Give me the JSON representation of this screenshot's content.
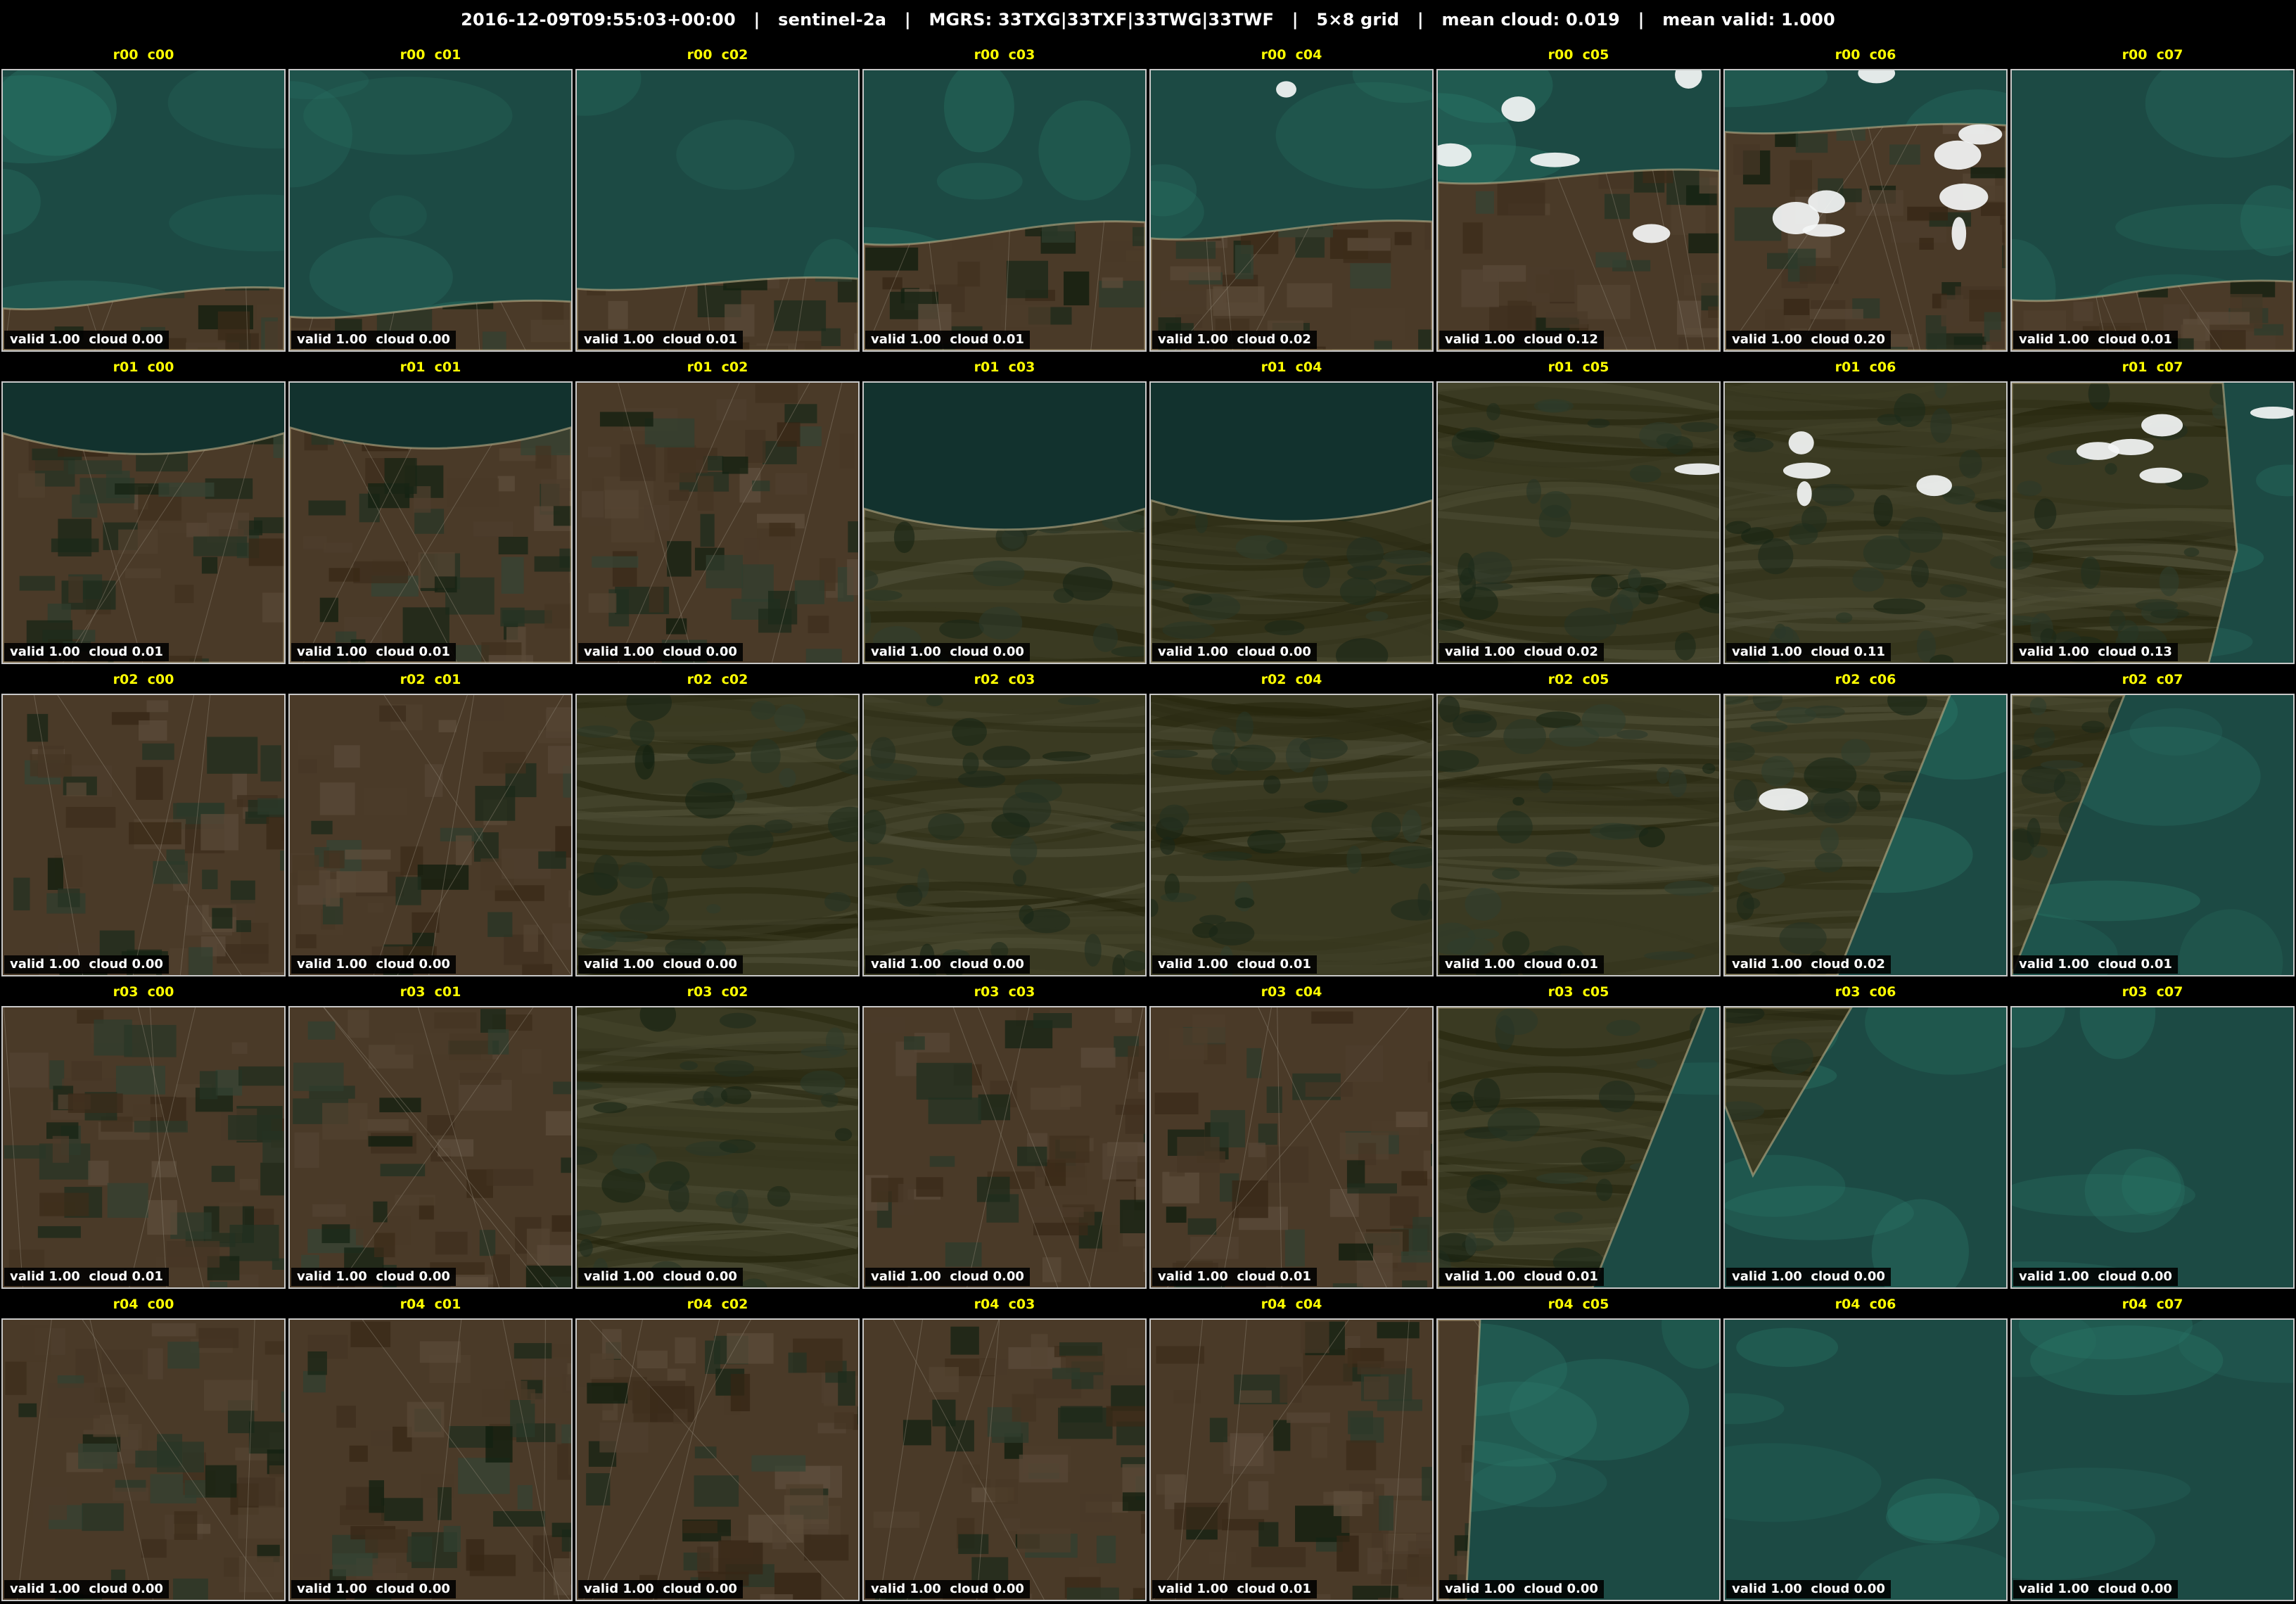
{
  "header": {
    "text": "2016-12-09T09:55:03+00:00   |   sentinel-2a   |   MGRS: 33TXG|33TXF|33TWG|33TWF   |   5×8 grid   |   mean cloud: 0.019   |   mean valid: 1.000"
  },
  "colors": {
    "sea": "#1c4a44",
    "sea_shallow": "#2a7a6a",
    "land": "#3a3a22",
    "farmland": "#4a3a28",
    "forest": "#223020",
    "cloud": "#f4f6f6",
    "label": "#ffff00",
    "border": "#c8c8c8"
  },
  "grid": {
    "rows": [
      {
        "cells": [
          {
            "label": "r00  c00",
            "stats": "valid 1.00  cloud 0.00",
            "scene": "sea-coast",
            "coast": 0.85,
            "cloud_fraction": 0.0
          },
          {
            "label": "r00  c01",
            "stats": "valid 1.00  cloud 0.00",
            "scene": "sea-coast",
            "coast": 0.88,
            "cloud_fraction": 0.0
          },
          {
            "label": "r00  c02",
            "stats": "valid 1.00  cloud 0.01",
            "scene": "sea-coast",
            "coast": 0.78,
            "cloud_fraction": 0.01
          },
          {
            "label": "r00  c03",
            "stats": "valid 1.00  cloud 0.01",
            "scene": "sea-lagoon",
            "coast": 0.62,
            "cloud_fraction": 0.01
          },
          {
            "label": "r00  c04",
            "stats": "valid 1.00  cloud 0.02",
            "scene": "sea-lagoon",
            "coast": 0.6,
            "cloud_fraction": 0.02
          },
          {
            "label": "r00  c05",
            "stats": "valid 1.00  cloud 0.12",
            "scene": "sea-coast",
            "coast": 0.4,
            "cloud_fraction": 0.12
          },
          {
            "label": "r00  c06",
            "stats": "valid 1.00  cloud 0.20",
            "scene": "sea-coast",
            "coast": 0.22,
            "cloud_fraction": 0.2
          },
          {
            "label": "r00  c07",
            "stats": "valid 1.00  cloud 0.01",
            "scene": "sea-coast",
            "coast": 0.82,
            "cloud_fraction": 0.01
          }
        ]
      },
      {
        "cells": [
          {
            "label": "r01  c00",
            "stats": "valid 1.00  cloud 0.01",
            "scene": "lake-farmland",
            "coast": 0.18,
            "cloud_fraction": 0.01
          },
          {
            "label": "r01  c01",
            "stats": "valid 1.00  cloud 0.01",
            "scene": "lake-farmland",
            "coast": 0.16,
            "cloud_fraction": 0.01
          },
          {
            "label": "r01  c02",
            "stats": "valid 1.00  cloud 0.00",
            "scene": "farmland",
            "coast": 0.0,
            "cloud_fraction": 0.0
          },
          {
            "label": "r01  c03",
            "stats": "valid 1.00  cloud 0.00",
            "scene": "lake-forest",
            "coast": 0.45,
            "cloud_fraction": 0.0
          },
          {
            "label": "r01  c04",
            "stats": "valid 1.00  cloud 0.00",
            "scene": "lake-forest",
            "coast": 0.42,
            "cloud_fraction": 0.0
          },
          {
            "label": "r01  c05",
            "stats": "valid 1.00  cloud 0.02",
            "scene": "mountain",
            "coast": 0.0,
            "cloud_fraction": 0.02
          },
          {
            "label": "r01  c06",
            "stats": "valid 1.00  cloud 0.11",
            "scene": "mountain",
            "coast": 0.0,
            "cloud_fraction": 0.11
          },
          {
            "label": "r01  c07",
            "stats": "valid 1.00  cloud 0.13",
            "scene": "coast-east",
            "coast": 0.75,
            "cloud_fraction": 0.13
          }
        ]
      },
      {
        "cells": [
          {
            "label": "r02  c00",
            "stats": "valid 1.00  cloud 0.00",
            "scene": "farmland",
            "coast": 0.0,
            "cloud_fraction": 0.0
          },
          {
            "label": "r02  c01",
            "stats": "valid 1.00  cloud 0.00",
            "scene": "farmland",
            "coast": 0.0,
            "cloud_fraction": 0.0
          },
          {
            "label": "r02  c02",
            "stats": "valid 1.00  cloud 0.00",
            "scene": "mountain",
            "coast": 0.0,
            "cloud_fraction": 0.0
          },
          {
            "label": "r02  c03",
            "stats": "valid 1.00  cloud 0.00",
            "scene": "mountain",
            "coast": 0.0,
            "cloud_fraction": 0.0
          },
          {
            "label": "r02  c04",
            "stats": "valid 1.00  cloud 0.01",
            "scene": "mountain",
            "coast": 0.0,
            "cloud_fraction": 0.01
          },
          {
            "label": "r02  c05",
            "stats": "valid 1.00  cloud 0.01",
            "scene": "mountain",
            "coast": 0.0,
            "cloud_fraction": 0.01
          },
          {
            "label": "r02  c06",
            "stats": "valid 1.00  cloud 0.02",
            "scene": "coast-diagonal",
            "coast": 0.7,
            "cloud_fraction": 0.02
          },
          {
            "label": "r02  c07",
            "stats": "valid 1.00  cloud 0.01",
            "scene": "coast-diagonal",
            "coast": 0.3,
            "cloud_fraction": 0.01
          }
        ]
      },
      {
        "cells": [
          {
            "label": "r03  c00",
            "stats": "valid 1.00  cloud 0.01",
            "scene": "farmland",
            "coast": 0.0,
            "cloud_fraction": 0.01
          },
          {
            "label": "r03  c01",
            "stats": "valid 1.00  cloud 0.00",
            "scene": "farmland",
            "coast": 0.0,
            "cloud_fraction": 0.0
          },
          {
            "label": "r03  c02",
            "stats": "valid 1.00  cloud 0.00",
            "scene": "mountain",
            "coast": 0.0,
            "cloud_fraction": 0.0
          },
          {
            "label": "r03  c03",
            "stats": "valid 1.00  cloud 0.00",
            "scene": "farmland",
            "coast": 0.0,
            "cloud_fraction": 0.0
          },
          {
            "label": "r03  c04",
            "stats": "valid 1.00  cloud 0.01",
            "scene": "farmland",
            "coast": 0.0,
            "cloud_fraction": 0.01
          },
          {
            "label": "r03  c05",
            "stats": "valid 1.00  cloud 0.01",
            "scene": "coast-diagonal",
            "coast": 0.85,
            "cloud_fraction": 0.01
          },
          {
            "label": "r03  c06",
            "stats": "valid 1.00  cloud 0.00",
            "scene": "sea-corner",
            "coast": 0.35,
            "cloud_fraction": 0.0
          },
          {
            "label": "r03  c07",
            "stats": "valid 1.00  cloud 0.00",
            "scene": "sea",
            "coast": 0.0,
            "cloud_fraction": 0.0
          }
        ]
      },
      {
        "cells": [
          {
            "label": "r04  c00",
            "stats": "valid 1.00  cloud 0.00",
            "scene": "farmland",
            "coast": 0.0,
            "cloud_fraction": 0.0
          },
          {
            "label": "r04  c01",
            "stats": "valid 1.00  cloud 0.00",
            "scene": "farmland",
            "coast": 0.0,
            "cloud_fraction": 0.0
          },
          {
            "label": "r04  c02",
            "stats": "valid 1.00  cloud 0.00",
            "scene": "farmland",
            "coast": 0.0,
            "cloud_fraction": 0.0
          },
          {
            "label": "r04  c03",
            "stats": "valid 1.00  cloud 0.00",
            "scene": "farmland",
            "coast": 0.0,
            "cloud_fraction": 0.0
          },
          {
            "label": "r04  c04",
            "stats": "valid 1.00  cloud 0.01",
            "scene": "farmland",
            "coast": 0.0,
            "cloud_fraction": 0.01
          },
          {
            "label": "r04  c05",
            "stats": "valid 1.00  cloud 0.00",
            "scene": "coast-west",
            "coast": 0.15,
            "cloud_fraction": 0.0
          },
          {
            "label": "r04  c06",
            "stats": "valid 1.00  cloud 0.00",
            "scene": "sea",
            "coast": 0.0,
            "cloud_fraction": 0.0
          },
          {
            "label": "r04  c07",
            "stats": "valid 1.00  cloud 0.00",
            "scene": "sea",
            "coast": 0.0,
            "cloud_fraction": 0.0
          }
        ]
      }
    ]
  }
}
